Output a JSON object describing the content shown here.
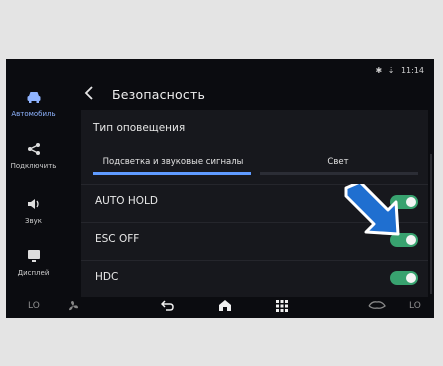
{
  "status": {
    "time": "11:14",
    "icons": [
      "bluetooth-icon",
      "network-icon"
    ]
  },
  "sidebar": {
    "items": [
      {
        "label": "Автомобиль",
        "icon": "car-icon",
        "active": true
      },
      {
        "label": "Подключить",
        "icon": "share-icon",
        "active": false
      },
      {
        "label": "Звук",
        "icon": "speaker-icon",
        "active": false
      },
      {
        "label": "Дисплей",
        "icon": "display-icon",
        "active": false
      }
    ]
  },
  "header": {
    "title": "Безопасность",
    "back_icon": "chevron-left-icon"
  },
  "notification": {
    "title": "Тип оповещения",
    "options": [
      "Подсветка и звуковые сигналы",
      "Свет"
    ],
    "selected": 0
  },
  "settings": [
    {
      "label": "AUTO HOLD",
      "state": "on"
    },
    {
      "label": "ESC OFF",
      "state": "on"
    },
    {
      "label": "HDC",
      "state": "on"
    }
  ],
  "bottombar": {
    "left_temp": "LO",
    "right_temp": "LO",
    "icons": [
      "fan-icon",
      "back-icon",
      "home-icon",
      "apps-icon",
      "seat-icon"
    ]
  },
  "colors": {
    "accent": "#5f9bff",
    "toggle_on": "#38a26f",
    "arrow": "#1f6fd0"
  }
}
